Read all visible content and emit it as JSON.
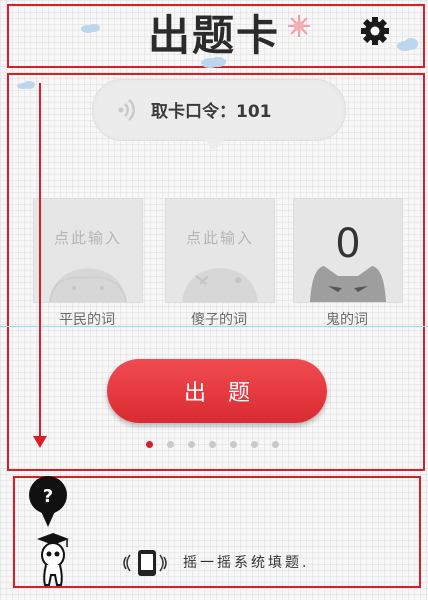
{
  "header": {
    "title": "出题卡",
    "settings_icon": "gear-icon"
  },
  "command": {
    "label": "取卡口令：101"
  },
  "cards": [
    {
      "entry": "点此输入",
      "label": "平民的词"
    },
    {
      "entry": "点此输入",
      "label": "傻子的词"
    },
    {
      "value": "0",
      "label": "鬼的词"
    }
  ],
  "action": {
    "button_label": "出题"
  },
  "pager": {
    "total": 7,
    "active": 1
  },
  "footer": {
    "help_icon": "?",
    "shake_text": "摇一摇系统填题."
  },
  "colors": {
    "accent": "#d61f26",
    "button": "#e33a40"
  }
}
